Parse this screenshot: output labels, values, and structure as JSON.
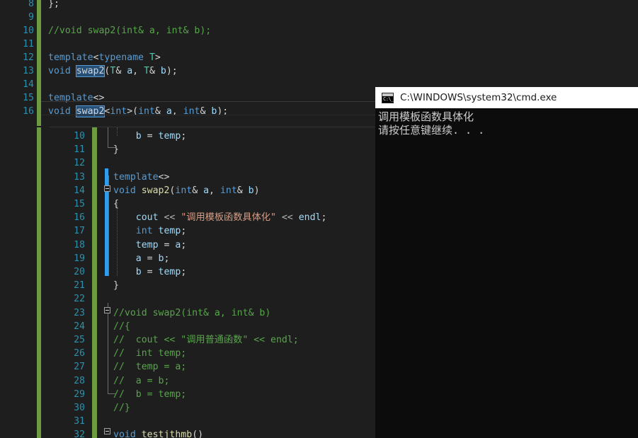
{
  "top_editor": {
    "name": "visual-studio-code-editor-top",
    "first_line_number": 8,
    "lines": [
      {
        "num": 8,
        "tokens": [
          {
            "t": "};",
            "c": "t-punct"
          }
        ],
        "indent": 1
      },
      {
        "num": 9,
        "tokens": [],
        "indent": 0
      },
      {
        "num": 10,
        "tokens": [
          {
            "t": "//void swap2(int& a, int& b);",
            "c": "t-com"
          }
        ],
        "indent": 1
      },
      {
        "num": 11,
        "tokens": [],
        "indent": 0
      },
      {
        "num": 12,
        "tokens": [
          {
            "t": "template",
            "c": "t-kw"
          },
          {
            "t": "<",
            "c": "t-punct"
          },
          {
            "t": "typename",
            "c": "t-kw"
          },
          {
            "t": " ",
            "c": "t-punct"
          },
          {
            "t": "T",
            "c": "t-type"
          },
          {
            "t": ">",
            "c": "t-punct"
          }
        ],
        "indent": 1
      },
      {
        "num": 13,
        "tokens": [
          {
            "t": "void",
            "c": "t-kw"
          },
          {
            "t": " ",
            "c": "t-punct"
          },
          {
            "t": "swap2",
            "c": "hl-box"
          },
          {
            "t": "(",
            "c": "t-punct"
          },
          {
            "t": "T",
            "c": "t-type"
          },
          {
            "t": "& ",
            "c": "t-punct"
          },
          {
            "t": "a",
            "c": "t-id"
          },
          {
            "t": ", ",
            "c": "t-punct"
          },
          {
            "t": "T",
            "c": "t-type"
          },
          {
            "t": "& ",
            "c": "t-punct"
          },
          {
            "t": "b",
            "c": "t-id"
          },
          {
            "t": ");",
            "c": "t-punct"
          }
        ],
        "indent": 1
      },
      {
        "num": 14,
        "tokens": [],
        "indent": 0
      },
      {
        "num": 15,
        "tokens": [
          {
            "t": "template",
            "c": "t-kw"
          },
          {
            "t": "<>",
            "c": "t-punct"
          }
        ],
        "indent": 1
      },
      {
        "num": 16,
        "tokens": [
          {
            "t": "void",
            "c": "t-kw"
          },
          {
            "t": " ",
            "c": "t-punct"
          },
          {
            "t": "swap2",
            "c": "hl-box"
          },
          {
            "t": "<",
            "c": "t-punct"
          },
          {
            "t": "int",
            "c": "t-kw"
          },
          {
            "t": ">(",
            "c": "t-punct"
          },
          {
            "t": "int",
            "c": "t-kw"
          },
          {
            "t": "& ",
            "c": "t-punct"
          },
          {
            "t": "a",
            "c": "t-id"
          },
          {
            "t": ", ",
            "c": "t-punct"
          },
          {
            "t": "int",
            "c": "t-kw"
          },
          {
            "t": "& ",
            "c": "t-punct"
          },
          {
            "t": "b",
            "c": "t-id"
          },
          {
            "t": ");",
            "c": "t-punct"
          }
        ],
        "indent": 1
      }
    ]
  },
  "bottom_editor": {
    "name": "visual-studio-code-editor-bottom",
    "lines": [
      {
        "num": 10,
        "tokens": [
          {
            "t": "    ",
            "c": "t-punct"
          },
          {
            "t": "b",
            "c": "t-id"
          },
          {
            "t": " = ",
            "c": "t-punct"
          },
          {
            "t": "temp",
            "c": "t-id"
          },
          {
            "t": ";",
            "c": "t-punct"
          }
        ]
      },
      {
        "num": 11,
        "tokens": [
          {
            "t": "}",
            "c": "t-punct"
          }
        ]
      },
      {
        "num": 12,
        "tokens": []
      },
      {
        "num": 13,
        "tokens": [
          {
            "t": "template",
            "c": "t-kw"
          },
          {
            "t": "<>",
            "c": "t-punct"
          }
        ]
      },
      {
        "num": 14,
        "tokens": [
          {
            "t": "void",
            "c": "t-kw"
          },
          {
            "t": " ",
            "c": "t-punct"
          },
          {
            "t": "swap2",
            "c": "t-fn"
          },
          {
            "t": "(",
            "c": "t-punct"
          },
          {
            "t": "int",
            "c": "t-kw"
          },
          {
            "t": "& ",
            "c": "t-punct"
          },
          {
            "t": "a",
            "c": "t-id"
          },
          {
            "t": ", ",
            "c": "t-punct"
          },
          {
            "t": "int",
            "c": "t-kw"
          },
          {
            "t": "& ",
            "c": "t-punct"
          },
          {
            "t": "b",
            "c": "t-id"
          },
          {
            "t": ")",
            "c": "t-punct"
          }
        ]
      },
      {
        "num": 15,
        "tokens": [
          {
            "t": "{",
            "c": "t-punct"
          }
        ]
      },
      {
        "num": 16,
        "tokens": [
          {
            "t": "    ",
            "c": "t-punct"
          },
          {
            "t": "cout",
            "c": "t-id"
          },
          {
            "t": " ",
            "c": "t-punct"
          },
          {
            "t": "<<",
            "c": "t-op"
          },
          {
            "t": " ",
            "c": "t-punct"
          },
          {
            "t": "\"调用模板函数具体化\"",
            "c": "t-str"
          },
          {
            "t": " ",
            "c": "t-punct"
          },
          {
            "t": "<<",
            "c": "t-op"
          },
          {
            "t": " ",
            "c": "t-punct"
          },
          {
            "t": "endl",
            "c": "t-id"
          },
          {
            "t": ";",
            "c": "t-punct"
          }
        ]
      },
      {
        "num": 17,
        "tokens": [
          {
            "t": "    ",
            "c": "t-punct"
          },
          {
            "t": "int",
            "c": "t-kw"
          },
          {
            "t": " ",
            "c": "t-punct"
          },
          {
            "t": "temp",
            "c": "t-id"
          },
          {
            "t": ";",
            "c": "t-punct"
          }
        ]
      },
      {
        "num": 18,
        "tokens": [
          {
            "t": "    ",
            "c": "t-punct"
          },
          {
            "t": "temp",
            "c": "t-id"
          },
          {
            "t": " = ",
            "c": "t-punct"
          },
          {
            "t": "a",
            "c": "t-id"
          },
          {
            "t": ";",
            "c": "t-punct"
          }
        ]
      },
      {
        "num": 19,
        "tokens": [
          {
            "t": "    ",
            "c": "t-punct"
          },
          {
            "t": "a",
            "c": "t-id"
          },
          {
            "t": " = ",
            "c": "t-punct"
          },
          {
            "t": "b",
            "c": "t-id"
          },
          {
            "t": ";",
            "c": "t-punct"
          }
        ]
      },
      {
        "num": 20,
        "tokens": [
          {
            "t": "    ",
            "c": "t-punct"
          },
          {
            "t": "b",
            "c": "t-id"
          },
          {
            "t": " = ",
            "c": "t-punct"
          },
          {
            "t": "temp",
            "c": "t-id"
          },
          {
            "t": ";",
            "c": "t-punct"
          }
        ]
      },
      {
        "num": 21,
        "tokens": [
          {
            "t": "}",
            "c": "t-punct"
          }
        ]
      },
      {
        "num": 22,
        "tokens": []
      },
      {
        "num": 23,
        "tokens": [
          {
            "t": "//void swap2(int& a, int& b)",
            "c": "t-com"
          }
        ]
      },
      {
        "num": 24,
        "tokens": [
          {
            "t": "//{",
            "c": "t-com"
          }
        ]
      },
      {
        "num": 25,
        "tokens": [
          {
            "t": "//  cout << \"调用普通函数\" << endl;",
            "c": "t-com"
          }
        ]
      },
      {
        "num": 26,
        "tokens": [
          {
            "t": "//  int temp;",
            "c": "t-com"
          }
        ]
      },
      {
        "num": 27,
        "tokens": [
          {
            "t": "//  temp = a;",
            "c": "t-com"
          }
        ]
      },
      {
        "num": 28,
        "tokens": [
          {
            "t": "//  a = b;",
            "c": "t-com"
          }
        ]
      },
      {
        "num": 29,
        "tokens": [
          {
            "t": "//  b = temp;",
            "c": "t-com"
          }
        ]
      },
      {
        "num": 30,
        "tokens": [
          {
            "t": "//}",
            "c": "t-com"
          }
        ]
      },
      {
        "num": 31,
        "tokens": []
      },
      {
        "num": 32,
        "tokens": [
          {
            "t": "void",
            "c": "t-kw"
          },
          {
            "t": " ",
            "c": "t-punct"
          },
          {
            "t": "testjthmb",
            "c": "t-fn"
          },
          {
            "t": "()",
            "c": "t-punct"
          }
        ]
      }
    ]
  },
  "console": {
    "title": "C:\\WINDOWS\\system32\\cmd.exe",
    "icon_label": "C:\\_",
    "output": [
      "调用模板函数具体化",
      "请按任意键继续. . ."
    ]
  },
  "colors": {
    "editor_background": "#1e1e1e",
    "line_number": "#2b91af",
    "keyword": "#569cd6",
    "type": "#4ec9b0",
    "function": "#dcdcaa",
    "identifier": "#9cdcfe",
    "string": "#d69d85",
    "comment": "#57a64a",
    "selection_highlight": "#264f78",
    "changed_marker_green": "#6d9b41",
    "saved_marker_blue": "#2f9ded",
    "console_background": "#0c0c0c",
    "console_titlebar": "#ffffff",
    "console_text": "#cccccc"
  }
}
